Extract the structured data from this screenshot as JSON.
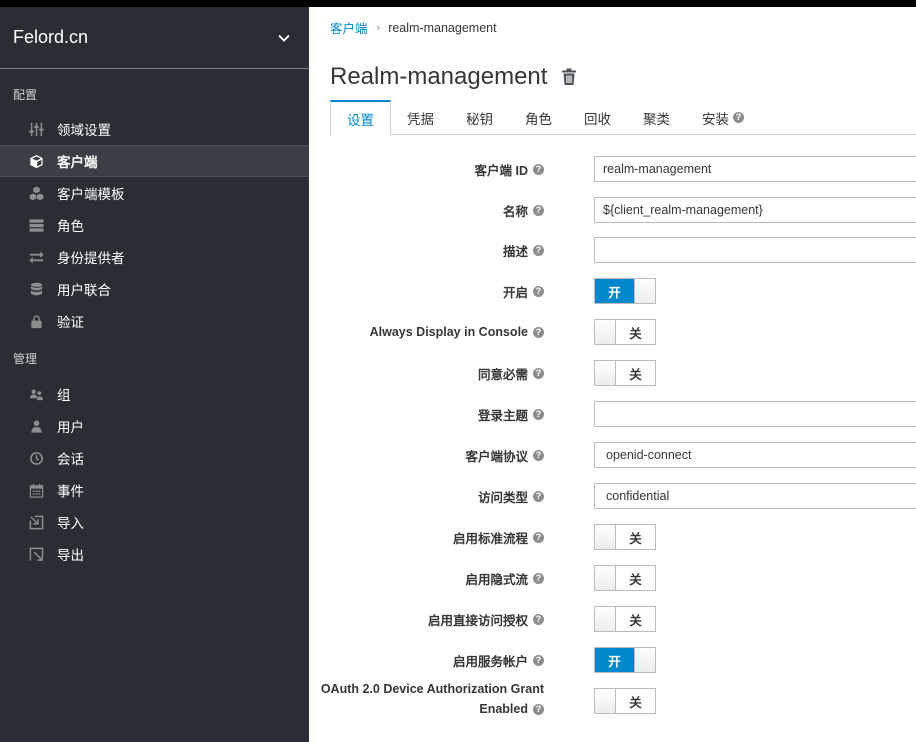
{
  "sidebar": {
    "realm": "Felord.cn",
    "config_heading": "配置",
    "manage_heading": "管理",
    "config_items": [
      {
        "label": "领域设置",
        "icon": "sliders-icon"
      },
      {
        "label": "客户端",
        "icon": "cube-icon"
      },
      {
        "label": "客户端模板",
        "icon": "cubes-icon"
      },
      {
        "label": "角色",
        "icon": "list-icon"
      },
      {
        "label": "身份提供者",
        "icon": "exchange-icon"
      },
      {
        "label": "用户联合",
        "icon": "database-icon"
      },
      {
        "label": "验证",
        "icon": "lock-icon"
      }
    ],
    "manage_items": [
      {
        "label": "组",
        "icon": "users-icon"
      },
      {
        "label": "用户",
        "icon": "user-icon"
      },
      {
        "label": "会话",
        "icon": "clock-icon"
      },
      {
        "label": "事件",
        "icon": "calendar-icon"
      },
      {
        "label": "导入",
        "icon": "import-icon"
      },
      {
        "label": "导出",
        "icon": "export-icon"
      }
    ]
  },
  "breadcrumb": {
    "parent": "客户端",
    "current": "realm-management"
  },
  "title": "Realm-management",
  "tabs": [
    "设置",
    "凭据",
    "秘钥",
    "角色",
    "回收",
    "聚类",
    "安装"
  ],
  "help_glyph": "?",
  "toggle_on_label": "开",
  "toggle_off_label": "关",
  "form": {
    "client_id_label": "客户端 ID",
    "client_id_value": "realm-management",
    "name_label": "名称",
    "name_value": "${client_realm-management}",
    "description_label": "描述",
    "description_value": "",
    "enabled_label": "开启",
    "enabled": true,
    "always_display_label": "Always Display in Console",
    "always_display": false,
    "consent_label": "同意必需",
    "consent": false,
    "login_theme_label": "登录主题",
    "login_theme_value": "",
    "protocol_label": "客户端协议",
    "protocol_value": "openid-connect",
    "access_type_label": "访问类型",
    "access_type_value": "confidential",
    "standard_flow_label": "启用标准流程",
    "standard_flow": false,
    "implicit_flow_label": "启用隐式流",
    "implicit_flow": false,
    "direct_access_label": "启用直接访问授权",
    "direct_access": false,
    "service_accounts_label": "启用服务帐户",
    "service_accounts": true,
    "device_grant_label_1": "OAuth 2.0 Device Authorization Grant",
    "device_grant_label_2": "Enabled",
    "device_grant": false
  },
  "colors": {
    "sidebar": "#292e34",
    "accent": "#0088ce"
  }
}
